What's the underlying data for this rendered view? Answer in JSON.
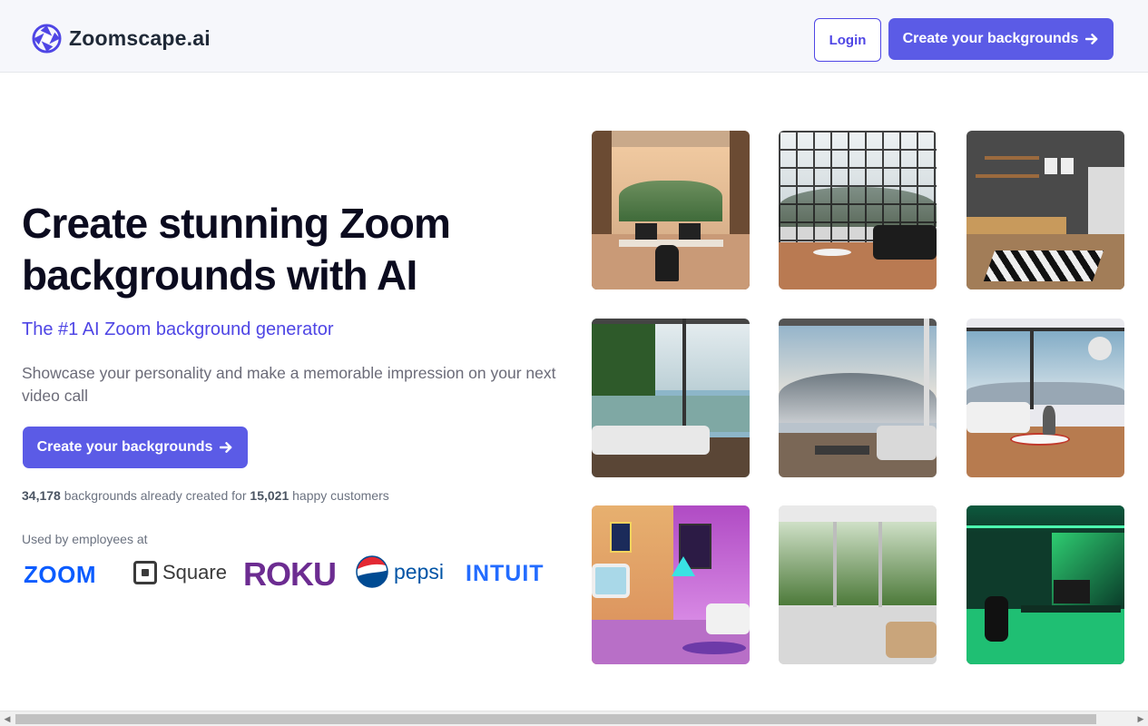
{
  "header": {
    "brand_name": "Zoomscape.ai",
    "login_label": "Login",
    "cta_label": "Create your backgrounds"
  },
  "hero": {
    "title": "Create stunning Zoom backgrounds with AI",
    "subtitle": "The #1 AI Zoom background generator",
    "description": "Showcase your personality and make a memorable impression on your next video call",
    "cta_label": "Create your backgrounds",
    "stats": {
      "backgrounds_count": "34,178",
      "middle_text": " backgrounds already created for ",
      "customers_count": "15,021",
      "end_text": " happy customers"
    },
    "used_by_label": "Used by employees at",
    "logos": [
      "ZOOM",
      "Square",
      "ROKU",
      "pepsi",
      "INTUIT"
    ]
  },
  "gallery": {
    "images": [
      "office-with-mountain-view",
      "living-room-black-sofa-grid-window",
      "modern-living-room-shelves",
      "lounge-with-lake-view",
      "snowy-mountain-living-room",
      "winter-lake-living-room",
      "retro-neon-room",
      "glass-house-forest-view",
      "green-neon-gaming-office"
    ]
  },
  "colors": {
    "accent": "#5b5be6",
    "brand_indigo": "#4f46e5",
    "heading": "#0b0b1f",
    "header_bg": "#f6f7fb"
  },
  "icons": {
    "brand": "aperture-logo-icon",
    "cta": "arrow-right-icon"
  }
}
